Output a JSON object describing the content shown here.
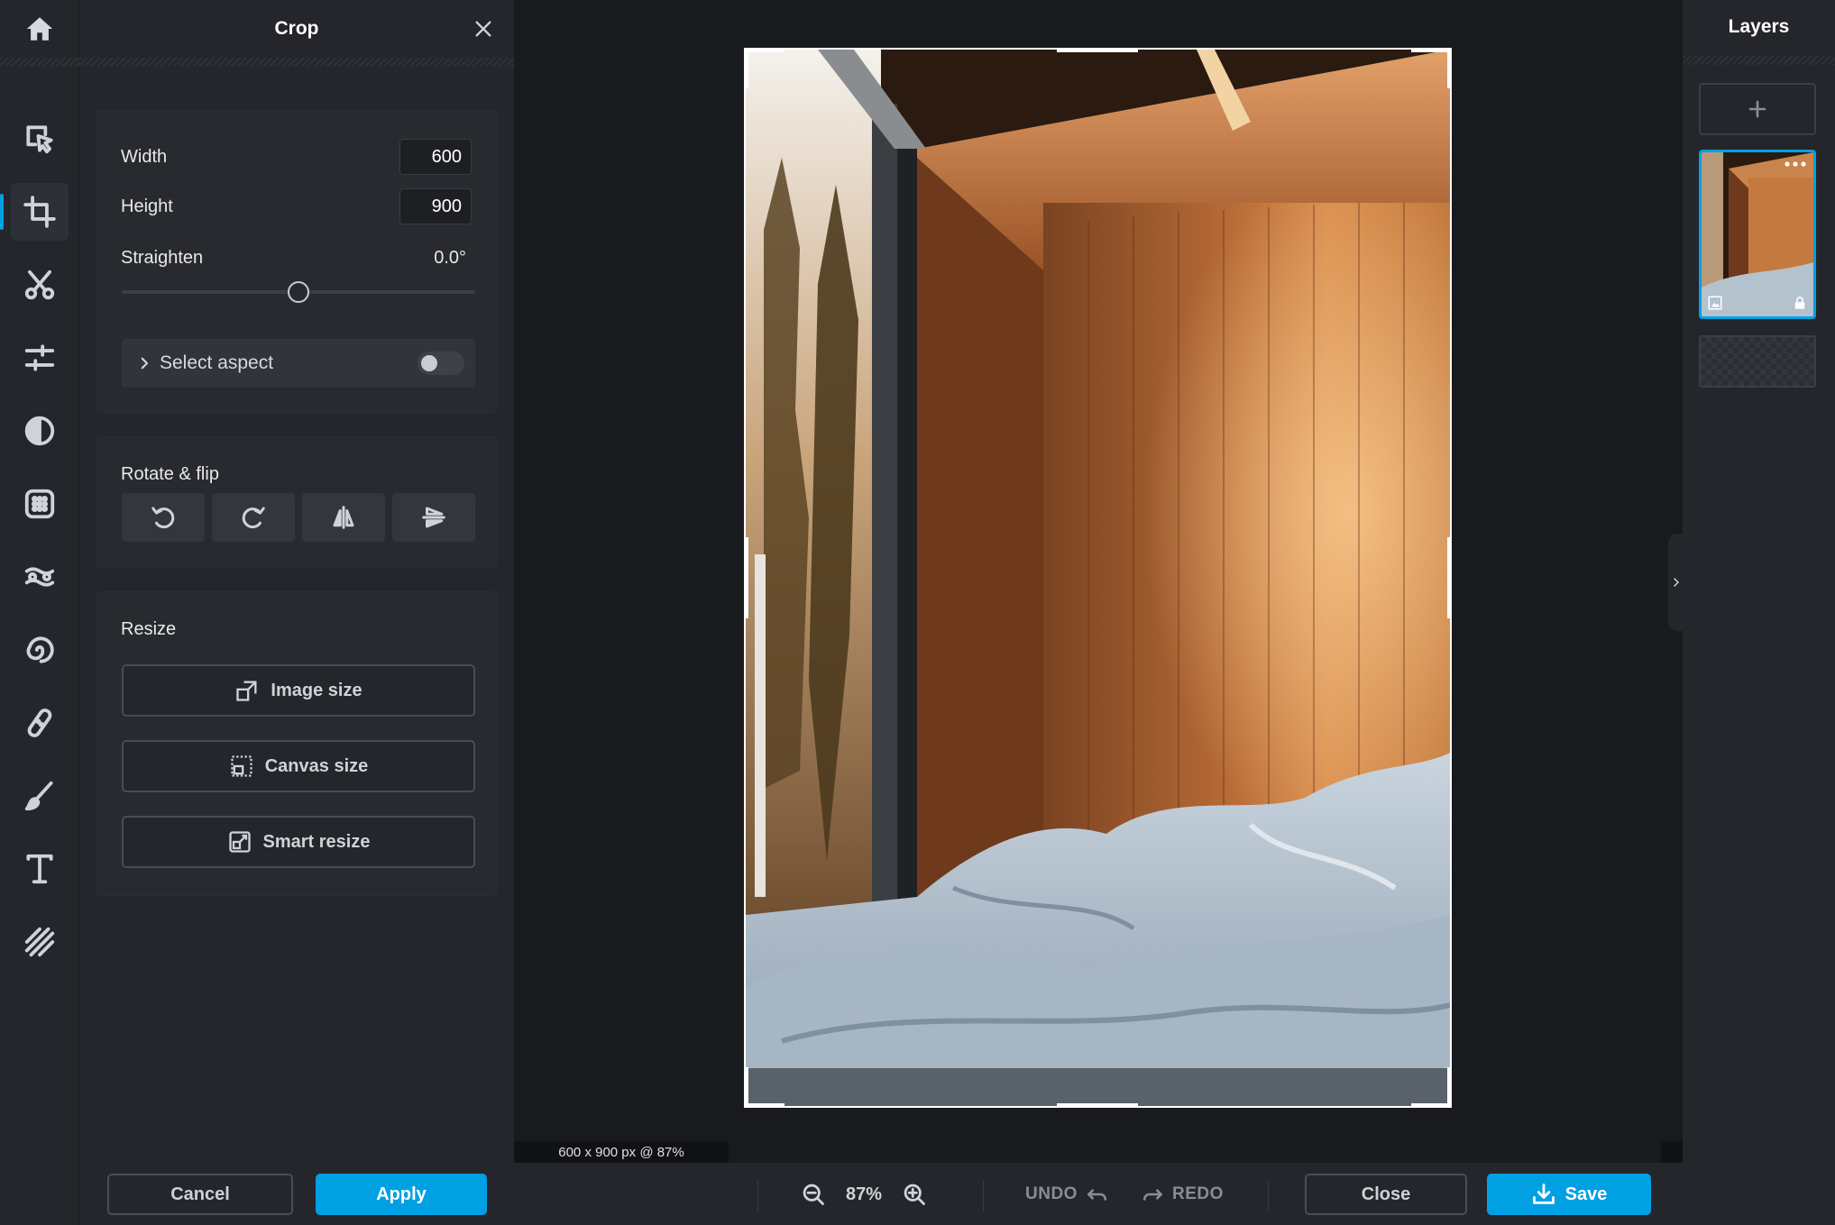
{
  "panel": {
    "title": "Crop",
    "width_label": "Width",
    "width_value": "600",
    "height_label": "Height",
    "height_value": "900",
    "straighten_label": "Straighten",
    "straighten_value": "0.0°",
    "straighten_level": 0.5,
    "aspect_label": "Select aspect",
    "aspect_toggle_on": false,
    "rotate_title": "Rotate & flip",
    "resize_title": "Resize",
    "image_size_label": "Image size",
    "canvas_size_label": "Canvas size",
    "smart_resize_label": "Smart resize"
  },
  "toolbar": {
    "tools": [
      "home-icon",
      "arrange-icon",
      "crop-icon",
      "cutout-icon",
      "adjust-icon",
      "filter-icon",
      "effects-icon",
      "liquify-icon",
      "distort-icon",
      "retouch-icon",
      "draw-icon",
      "text-icon",
      "pattern-icon"
    ],
    "active": "crop-icon"
  },
  "canvas": {
    "info": "600 x 900 px @ 87%"
  },
  "layers": {
    "title": "Layers"
  },
  "bottom": {
    "cancel": "Cancel",
    "apply": "Apply",
    "zoom": "87%",
    "undo": "UNDO",
    "redo": "REDO",
    "close": "Close",
    "save": "Save"
  },
  "colors": {
    "accent": "#00a0e3",
    "panel_bg": "#24262c",
    "canvas_bg": "#191a1d"
  }
}
